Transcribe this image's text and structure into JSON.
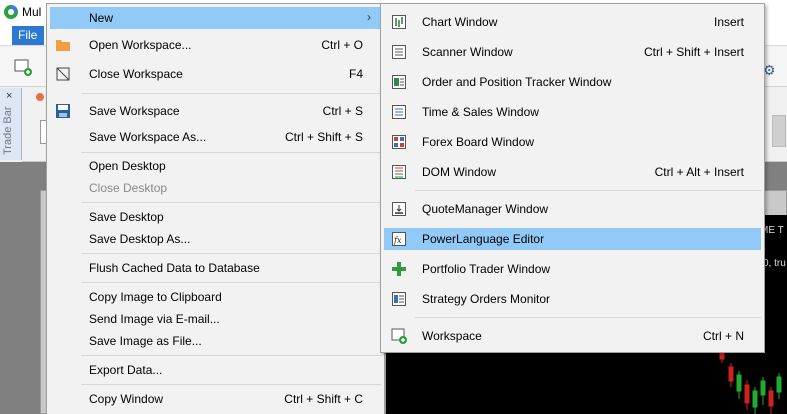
{
  "app": {
    "title": "Mul"
  },
  "menubar": {
    "file": "File"
  },
  "tradebar": {
    "label": "Trade Bar",
    "close": "×"
  },
  "chart": {
    "text_a": "ME T",
    "text_b": "0, tru"
  },
  "file_menu": {
    "items": [
      {
        "label": "New",
        "shortcut": "",
        "icon": "none",
        "highlight": true,
        "submenu": true
      },
      {
        "label": "Open Workspace...",
        "shortcut": "Ctrl + O",
        "icon": "folder-icon"
      },
      {
        "label": "Close Workspace",
        "shortcut": "F4",
        "icon": "close-workspace-icon"
      },
      {
        "label": "Save Workspace",
        "shortcut": "Ctrl + S",
        "icon": "save-icon"
      },
      {
        "label": "Save Workspace As...",
        "shortcut": "Ctrl + Shift + S"
      },
      {
        "label": "Open Desktop",
        "shortcut": ""
      },
      {
        "label": "Close Desktop",
        "shortcut": "",
        "disabled": true
      },
      {
        "label": "Save Desktop",
        "shortcut": ""
      },
      {
        "label": "Save Desktop As...",
        "shortcut": ""
      },
      {
        "label": "Flush Cached Data to Database",
        "shortcut": ""
      },
      {
        "label": "Copy Image to Clipboard",
        "shortcut": ""
      },
      {
        "label": "Send Image via E-mail...",
        "shortcut": ""
      },
      {
        "label": "Save Image as File...",
        "shortcut": ""
      },
      {
        "label": "Export Data...",
        "shortcut": ""
      },
      {
        "label": "Copy Window",
        "shortcut": "Ctrl + Shift + C"
      }
    ]
  },
  "new_submenu": {
    "items": [
      {
        "label": "Chart Window",
        "shortcut": "Insert",
        "icon": "chart-window-icon"
      },
      {
        "label": "Scanner Window",
        "shortcut": "Ctrl + Shift + Insert",
        "icon": "scanner-window-icon"
      },
      {
        "label": "Order and Position Tracker Window",
        "shortcut": "",
        "icon": "order-tracker-icon"
      },
      {
        "label": "Time & Sales Window",
        "shortcut": "",
        "icon": "time-sales-icon"
      },
      {
        "label": "Forex Board Window",
        "shortcut": "",
        "icon": "forex-board-icon"
      },
      {
        "label": "DOM Window",
        "shortcut": "Ctrl + Alt + Insert",
        "icon": "dom-window-icon"
      },
      {
        "label": "QuoteManager Window",
        "shortcut": "",
        "icon": "quotemanager-icon"
      },
      {
        "label": "PowerLanguage Editor",
        "shortcut": "",
        "icon": "powerlanguage-icon",
        "highlight": true
      },
      {
        "label": "Portfolio Trader Window",
        "shortcut": "",
        "icon": "portfolio-trader-icon"
      },
      {
        "label": "Strategy Orders Monitor",
        "shortcut": "",
        "icon": "strategy-orders-icon"
      },
      {
        "label": "Workspace",
        "shortcut": "Ctrl + N",
        "icon": "workspace-icon"
      }
    ]
  },
  "colors": {
    "highlight": "#91c9f7",
    "menu_bg": "#f2f2f2",
    "file_menu_button": "#2b79d0"
  }
}
